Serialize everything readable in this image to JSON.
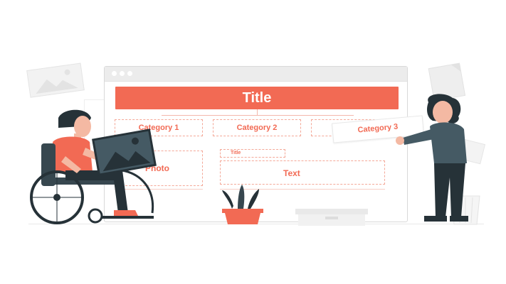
{
  "wireframe": {
    "title": "Title",
    "category_1": "Category 1",
    "category_2": "Category 2",
    "category_3": "Category 3",
    "photo_label": "Photo",
    "small_title": "Title",
    "text_label": "Text"
  },
  "colors": {
    "accent": "#f26a54",
    "dark": "#263238",
    "light_gray": "#ececec"
  },
  "icons": [
    "image-placeholder-icon",
    "document-icon",
    "cactus-plant",
    "wheelchair"
  ]
}
